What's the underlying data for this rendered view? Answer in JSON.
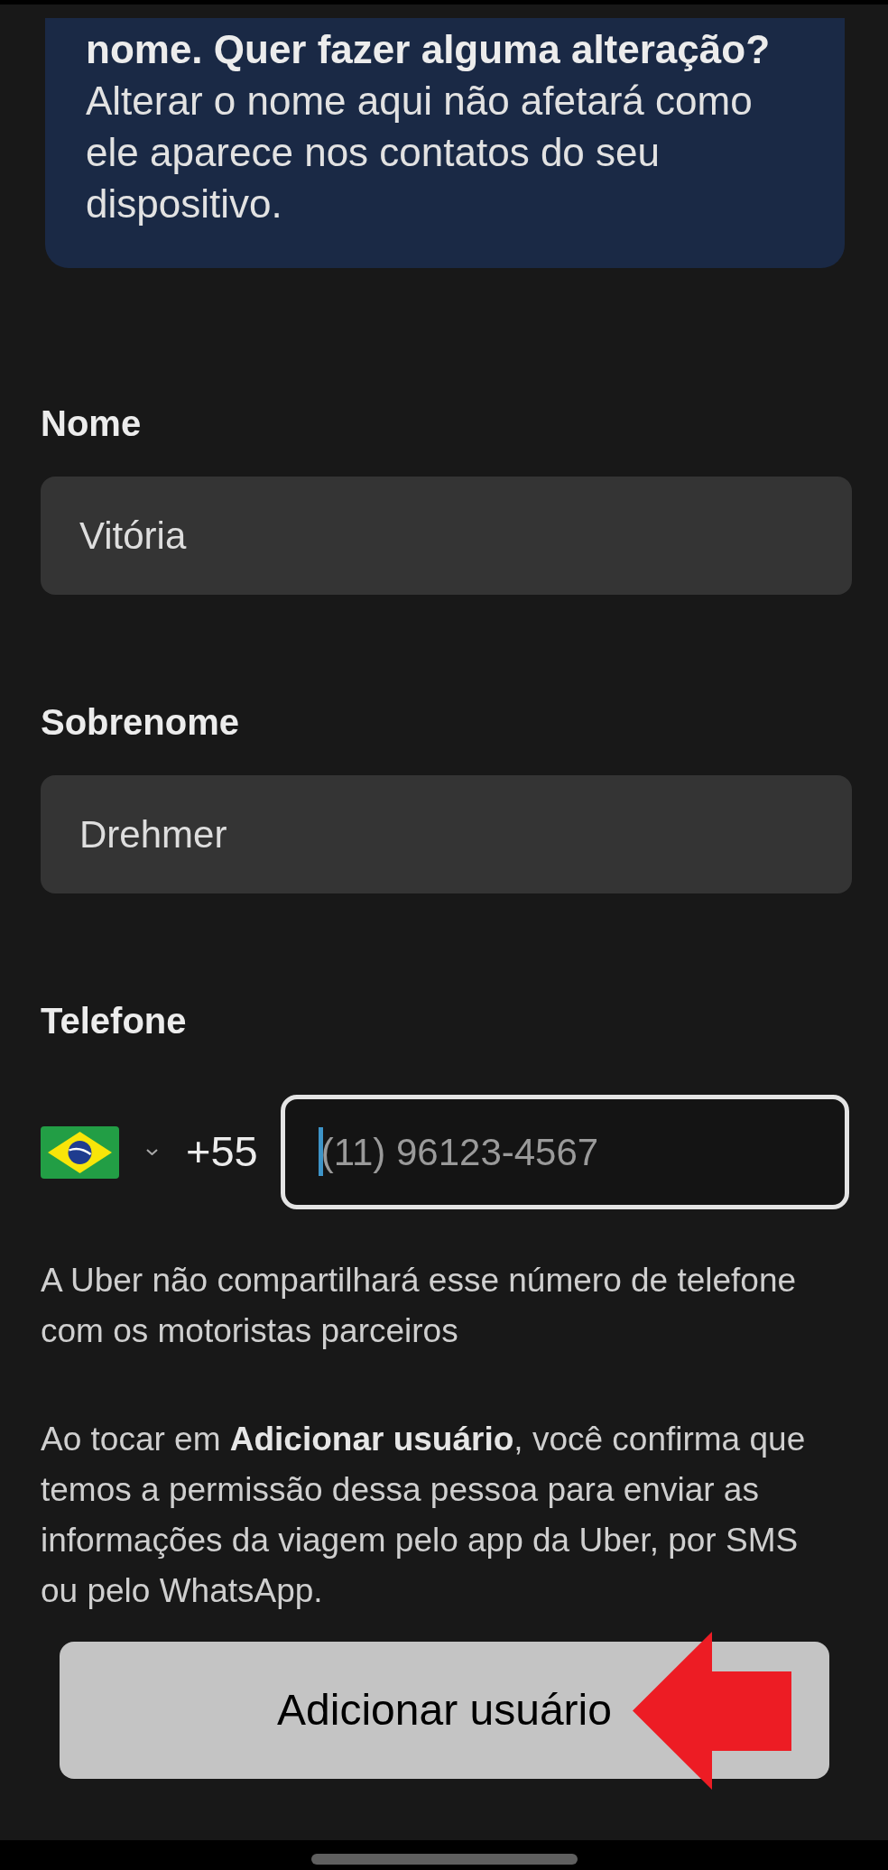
{
  "info_card": {
    "heading": "nome. Quer fazer alguma alteração?",
    "text": "Alterar o nome aqui não afetará como ele aparece nos contatos do seu dispositivo."
  },
  "fields": [
    {
      "label": "Nome",
      "value": "Vitória"
    },
    {
      "label": "Sobrenome",
      "value": "Drehmer"
    }
  ],
  "phone": {
    "label": "Telefone",
    "country_code": "+55",
    "placeholder": "(11) 96123-4567",
    "focused": true
  },
  "notes": [
    "A Uber não compartilhará esse número de telefone com os motoristas parceiros",
    "Ao tocar em **Adicionar usuário**, você confirma que temos a permissão dessa pessoa para enviar as informações da viagem pelo app da Uber, por SMS ou pelo WhatsApp."
  ],
  "button": {
    "label": "Adicionar usuário"
  },
  "annotations": [
    {
      "kind": "arrow"
    }
  ]
}
